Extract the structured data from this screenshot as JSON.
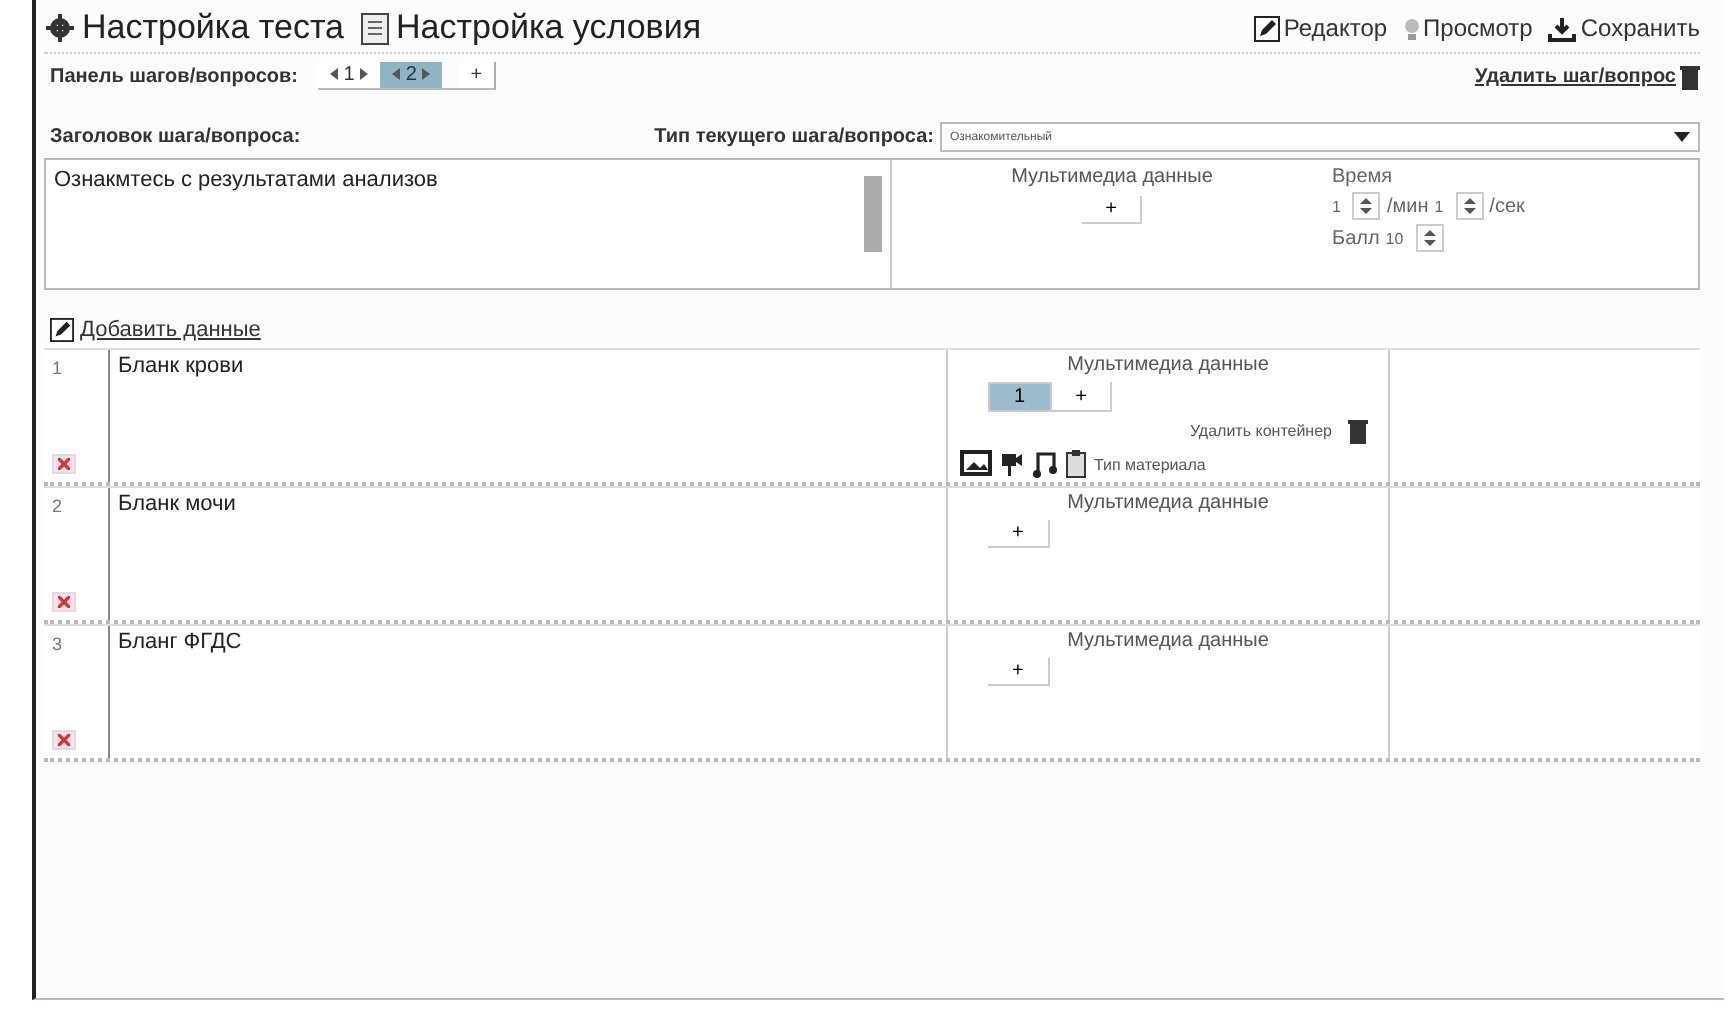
{
  "nav": [
    {
      "kind": "gear",
      "label": "Настройка теста"
    },
    {
      "kind": "doc",
      "label": "Настройка условия"
    }
  ],
  "actions": [
    {
      "kind": "edit",
      "label": "Редактор"
    },
    {
      "kind": "bulb",
      "label": "Просмотр"
    },
    {
      "kind": "save",
      "label": "Сохранить"
    }
  ],
  "steps_panel": {
    "label": "Панель шагов/вопросов:",
    "steps": [
      {
        "label": "1",
        "selected": false
      },
      {
        "label": "2",
        "selected": true
      }
    ],
    "add": "+"
  },
  "delete_step": "Удалить шаг/вопрос",
  "step_title": {
    "label": "Заголовок шага/вопроса:",
    "value": "Ознакмтесь с результатами анализов"
  },
  "step_type": {
    "label": "Тип текущего шага/вопроса:",
    "value": "Ознакомительный"
  },
  "multimedia": {
    "heading": "Мультимедиа данные",
    "add": "+"
  },
  "time": {
    "label": "Время",
    "minutes": "1",
    "min_unit": "/мин",
    "seconds": "1",
    "sec_unit": "/сек",
    "score_label": "Балл",
    "score": "10"
  },
  "add_data": "Добавить данные",
  "items": [
    {
      "number": "1",
      "text": "Бланк крови",
      "media_heading": "Мультимедиа данные",
      "tabs": [
        {
          "label": "1",
          "selected": true
        }
      ],
      "add": "+",
      "delete_container": "Удалить контейнер",
      "material_label": "Тип материала"
    },
    {
      "number": "2",
      "text": "Бланк мочи",
      "media_heading": "Мультимедиа данные",
      "add": "+"
    },
    {
      "number": "3",
      "text": "Бланг ФГДС",
      "media_heading": "Мультимедиа данные",
      "add": "+"
    }
  ]
}
